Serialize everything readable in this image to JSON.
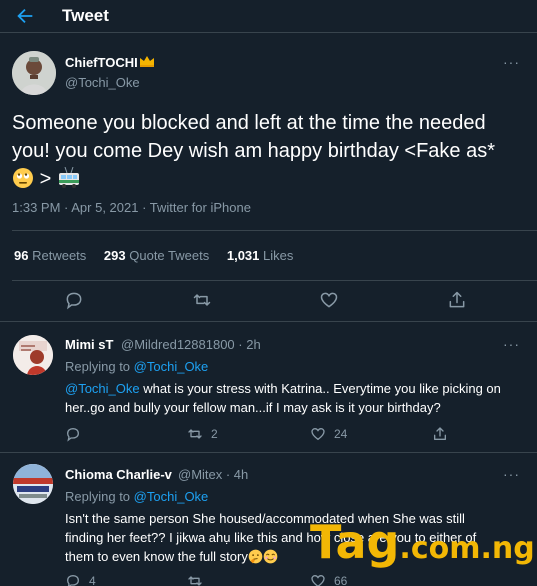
{
  "header": {
    "title": "Tweet"
  },
  "tweet": {
    "author_name": "ChiefTOCHI",
    "author_handle": "@Tochi_Oke",
    "text_line1": "Someone you blocked and left at the time the needed",
    "text_line2": "you! you come Dey wish am happy birthday <Fake as*",
    "text_line3": ">",
    "timestamp": "1:33 PM · Apr 5, 2021 · Twitter for iPhone",
    "retweets_count": "96",
    "retweets_label": "Retweets",
    "quotes_count": "293",
    "quotes_label": "Quote Tweets",
    "likes_count": "1,031",
    "likes_label": "Likes"
  },
  "replies": [
    {
      "name": "Mimi sT",
      "handle_time": "@Mildred12881800 · 2h",
      "replying_prefix": "Replying to",
      "replying_to": "@Tochi_Oke",
      "mention": "@Tochi_Oke",
      "text_line1": " what is your stress with Katrina.. Everytime you like picking on",
      "text_line2": "her..go and bully your fellow man...if I may ask is it your birthday?",
      "reply_count": "",
      "retweet_count": "2",
      "like_count": "24"
    },
    {
      "name": "Chioma Charlie-v",
      "handle_time": "@Mitex · 4h",
      "replying_prefix": "Replying to",
      "replying_to": "@Tochi_Oke",
      "text_line1": "Isn't the same person She housed/accommodated when She was still",
      "text_line2": "finding her feet?? I jikwa ahụ like this and how close are you to either of",
      "text_line3": "them to even know the full story",
      "reply_count": "4",
      "retweet_count": "",
      "like_count": "66"
    }
  ],
  "watermark": {
    "big": "Tag",
    "small": ".com.ng"
  },
  "colors": {
    "background": "#15202b",
    "accent": "#1da1f2",
    "muted": "#8899a6",
    "divider": "#38444d",
    "watermark": "#f2b705"
  }
}
